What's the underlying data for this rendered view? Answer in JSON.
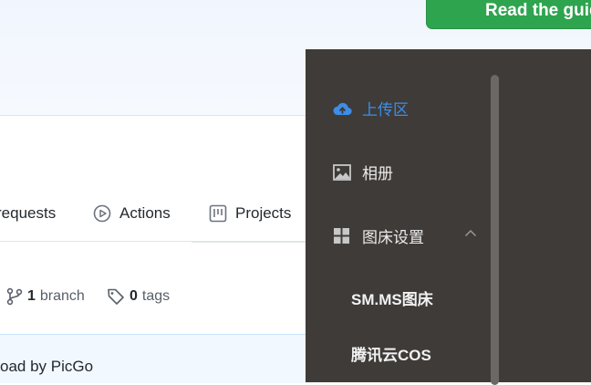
{
  "github": {
    "guide_button": "Read the guide",
    "tabs": [
      {
        "label": "requests",
        "icon": "pull-request-icon"
      },
      {
        "label": "Actions",
        "icon": "play-circle-icon"
      },
      {
        "label": "Projects",
        "icon": "project-board-icon"
      }
    ],
    "branch": {
      "count": "1",
      "label": "branch",
      "icon": "git-branch-icon"
    },
    "tags": {
      "count": "0",
      "label": "tags",
      "icon": "tag-icon"
    },
    "commit_message": "oad by PicGo"
  },
  "picgo_menu": {
    "items": [
      {
        "label": "上传区",
        "icon": "cloud-upload-icon",
        "active": true
      },
      {
        "label": "相册",
        "icon": "image-icon",
        "active": false
      },
      {
        "label": "图床设置",
        "icon": "grid-icon",
        "active": false,
        "expanded": true
      }
    ],
    "subitems": [
      {
        "label": "SM.MS图床"
      },
      {
        "label": "腾讯云COS"
      }
    ]
  },
  "colors": {
    "panel_bg": "#3f3b38",
    "active_item": "#3c8ee8",
    "github_green": "#2ea44f"
  }
}
